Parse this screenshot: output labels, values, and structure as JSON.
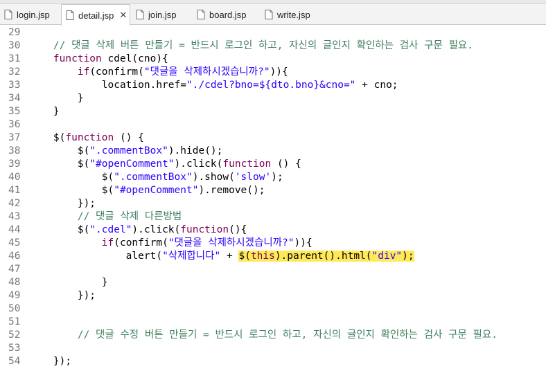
{
  "tabs": [
    {
      "label": "login.jsp",
      "active": false
    },
    {
      "label": "detail.jsp",
      "active": true
    },
    {
      "label": "join.jsp",
      "active": false
    },
    {
      "label": "board.jsp",
      "active": false
    },
    {
      "label": "write.jsp",
      "active": false
    }
  ],
  "close_glyph": "✕",
  "colors": {
    "keyword": "#7f0055",
    "string": "#2a00ff",
    "comment": "#3f7f5f",
    "highlight": "#ffe95a"
  },
  "lines": [
    {
      "n": "29",
      "parts": []
    },
    {
      "n": "30",
      "parts": [
        [
          "",
          "    "
        ],
        [
          "cm",
          "// 댓글 삭제 버튼 만들기 = 반드시 로그인 하고, 자신의 글인지 확인하는 검사 구문 필요."
        ]
      ]
    },
    {
      "n": "31",
      "parts": [
        [
          "",
          "    "
        ],
        [
          "kw",
          "function"
        ],
        [
          "",
          " cdel(cno){"
        ]
      ]
    },
    {
      "n": "32",
      "parts": [
        [
          "",
          "        "
        ],
        [
          "kw",
          "if"
        ],
        [
          "",
          "(confirm("
        ],
        [
          "str",
          "\"댓글을 삭제하시겠습니까?\""
        ],
        [
          "",
          ")){"
        ]
      ]
    },
    {
      "n": "33",
      "parts": [
        [
          "",
          "            location.href="
        ],
        [
          "str",
          "\"./cdel?bno=${dto.bno}&cno=\""
        ],
        [
          "",
          " + cno;"
        ]
      ]
    },
    {
      "n": "34",
      "parts": [
        [
          "",
          "        }"
        ]
      ]
    },
    {
      "n": "35",
      "parts": [
        [
          "",
          "    }"
        ]
      ]
    },
    {
      "n": "36",
      "parts": []
    },
    {
      "n": "37",
      "parts": [
        [
          "",
          "    $("
        ],
        [
          "kw",
          "function"
        ],
        [
          "",
          " () {"
        ]
      ]
    },
    {
      "n": "38",
      "parts": [
        [
          "",
          "        $("
        ],
        [
          "str",
          "\".commentBox\""
        ],
        [
          "",
          ").hide();"
        ]
      ]
    },
    {
      "n": "39",
      "parts": [
        [
          "",
          "        $("
        ],
        [
          "str",
          "\"#openComment\""
        ],
        [
          "",
          ").click("
        ],
        [
          "kw",
          "function"
        ],
        [
          "",
          " () {"
        ]
      ]
    },
    {
      "n": "40",
      "parts": [
        [
          "",
          "            $("
        ],
        [
          "str",
          "\".commentBox\""
        ],
        [
          "",
          ").show("
        ],
        [
          "str",
          "'slow'"
        ],
        [
          "",
          ");"
        ]
      ]
    },
    {
      "n": "41",
      "parts": [
        [
          "",
          "            $("
        ],
        [
          "str",
          "\"#openComment\""
        ],
        [
          "",
          ").remove();"
        ]
      ]
    },
    {
      "n": "42",
      "parts": [
        [
          "",
          "        });"
        ]
      ]
    },
    {
      "n": "43",
      "parts": [
        [
          "",
          "        "
        ],
        [
          "cm",
          "// 댓글 삭제 다른방법"
        ]
      ]
    },
    {
      "n": "44",
      "parts": [
        [
          "",
          "        $("
        ],
        [
          "str",
          "\".cdel\""
        ],
        [
          "",
          ").click("
        ],
        [
          "kw",
          "function"
        ],
        [
          "",
          "(){"
        ]
      ]
    },
    {
      "n": "45",
      "parts": [
        [
          "",
          "            "
        ],
        [
          "kw",
          "if"
        ],
        [
          "",
          "(confirm("
        ],
        [
          "str",
          "\"댓글을 삭제하시겠습니까?\""
        ],
        [
          "",
          ")){"
        ]
      ]
    },
    {
      "n": "46",
      "parts": [
        [
          "",
          "                alert("
        ],
        [
          "str",
          "\"삭제합니다\""
        ],
        [
          "",
          " + "
        ],
        [
          "hl",
          "$("
        ],
        [
          "hl kw",
          "this"
        ],
        [
          "hl",
          ").parent().html("
        ],
        [
          "hl str",
          "\"div\""
        ],
        [
          "hl",
          ");"
        ]
      ]
    },
    {
      "n": "47",
      "parts": []
    },
    {
      "n": "48",
      "parts": [
        [
          "",
          "            }"
        ]
      ]
    },
    {
      "n": "49",
      "parts": [
        [
          "",
          "        });"
        ]
      ]
    },
    {
      "n": "50",
      "parts": []
    },
    {
      "n": "51",
      "parts": []
    },
    {
      "n": "52",
      "parts": [
        [
          "",
          "        "
        ],
        [
          "cm",
          "// 댓글 수정 버튼 만들기 = 반드시 로그인 하고, 자신의 글인지 확인하는 검사 구문 필요."
        ]
      ]
    },
    {
      "n": "53",
      "parts": []
    },
    {
      "n": "54",
      "parts": [
        [
          "",
          "    });"
        ]
      ]
    }
  ]
}
